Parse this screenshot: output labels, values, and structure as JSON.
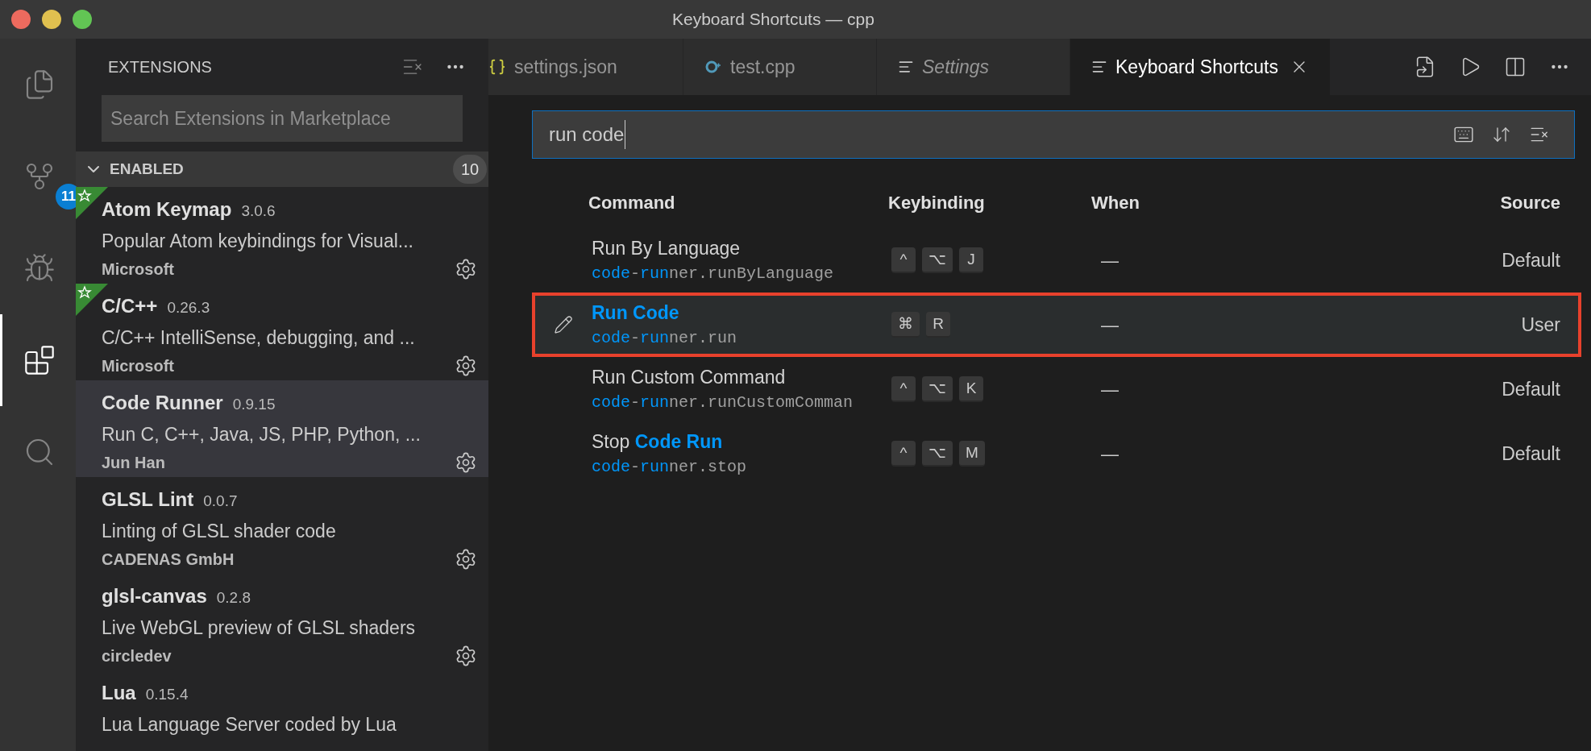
{
  "window": {
    "title": "Keyboard Shortcuts — cpp"
  },
  "activity_bar": [
    {
      "kind": "files",
      "selected": false
    },
    {
      "kind": "source-control",
      "badge": "11",
      "selected": false
    },
    {
      "kind": "debug",
      "selected": false
    },
    {
      "kind": "extensions",
      "selected": true
    },
    {
      "kind": "search",
      "selected": false
    }
  ],
  "sidebar": {
    "title": "EXTENSIONS",
    "search": {
      "placeholder": "Search Extensions in Marketplace"
    },
    "section": {
      "label": "ENABLED",
      "count": "10",
      "expanded": true
    },
    "extensions": [
      {
        "name": "Atom Keymap",
        "version": "3.0.6",
        "description": "Popular Atom keybindings for Visual...",
        "publisher": "Microsoft",
        "recommended": true,
        "selected": false
      },
      {
        "name": "C/C++",
        "version": "0.26.3",
        "description": "C/C++ IntelliSense, debugging, and ...",
        "publisher": "Microsoft",
        "recommended": true,
        "selected": false
      },
      {
        "name": "Code Runner",
        "version": "0.9.15",
        "description": "Run C, C++, Java, JS, PHP, Python, ...",
        "publisher": "Jun Han",
        "recommended": false,
        "selected": true
      },
      {
        "name": "GLSL Lint",
        "version": "0.0.7",
        "description": "Linting of GLSL shader code",
        "publisher": "CADENAS GmbH",
        "recommended": false,
        "selected": false
      },
      {
        "name": "glsl-canvas",
        "version": "0.2.8",
        "description": "Live WebGL preview of GLSL shaders",
        "publisher": "circledev",
        "recommended": false,
        "selected": false
      },
      {
        "name": "Lua",
        "version": "0.15.4",
        "description": "Lua Language Server coded by Lua",
        "recommended": false,
        "selected": false
      }
    ]
  },
  "tabs": [
    {
      "label": "settings.json",
      "kind": "json",
      "selected": false,
      "preview": false
    },
    {
      "label": "test.cpp",
      "kind": "cpp",
      "selected": false,
      "preview": false
    },
    {
      "label": "Settings",
      "kind": "lines",
      "selected": false,
      "preview": true
    },
    {
      "label": "Keyboard Shortcuts",
      "kind": "lines",
      "selected": true,
      "preview": false
    }
  ],
  "search": {
    "value": "run code"
  },
  "table": {
    "columns": [
      "Command",
      "Keybinding",
      "When",
      "Source"
    ],
    "rows": [
      {
        "title": [
          {
            "text": "Run By Language",
            "match": false
          }
        ],
        "command": [
          {
            "text": "code",
            "match": true
          },
          {
            "text": "-",
            "match": false
          },
          {
            "text": "run",
            "match": true
          },
          {
            "text": "ner.runByLanguage",
            "match": false
          }
        ],
        "keys": [
          "^",
          "⌥",
          "J"
        ],
        "when": "—",
        "source": "Default",
        "selected": false,
        "edited": false,
        "outlined": false
      },
      {
        "title": [
          {
            "text": "Run Code",
            "match": true
          }
        ],
        "command": [
          {
            "text": "code",
            "match": true
          },
          {
            "text": "-",
            "match": false
          },
          {
            "text": "run",
            "match": true
          },
          {
            "text": "ner.run",
            "match": false
          }
        ],
        "keys": [
          "⌘",
          "R"
        ],
        "when": "—",
        "source": "User",
        "selected": true,
        "edited": true,
        "outlined": true
      },
      {
        "title": [
          {
            "text": "Run Custom Command",
            "match": false
          }
        ],
        "command": [
          {
            "text": "code",
            "match": true
          },
          {
            "text": "-",
            "match": false
          },
          {
            "text": "run",
            "match": true
          },
          {
            "text": "ner.runCustomComman",
            "match": false
          }
        ],
        "keys": [
          "^",
          "⌥",
          "K"
        ],
        "when": "—",
        "source": "Default",
        "selected": false,
        "edited": false,
        "outlined": false
      },
      {
        "title": [
          {
            "text": "Stop ",
            "match": false
          },
          {
            "text": "Code Run",
            "match": true
          }
        ],
        "command": [
          {
            "text": "code",
            "match": true
          },
          {
            "text": "-",
            "match": false
          },
          {
            "text": "run",
            "match": true
          },
          {
            "text": "ner.stop",
            "match": false
          }
        ],
        "keys": [
          "^",
          "⌥",
          "M"
        ],
        "when": "—",
        "source": "Default",
        "selected": false,
        "edited": false,
        "outlined": false
      }
    ]
  }
}
